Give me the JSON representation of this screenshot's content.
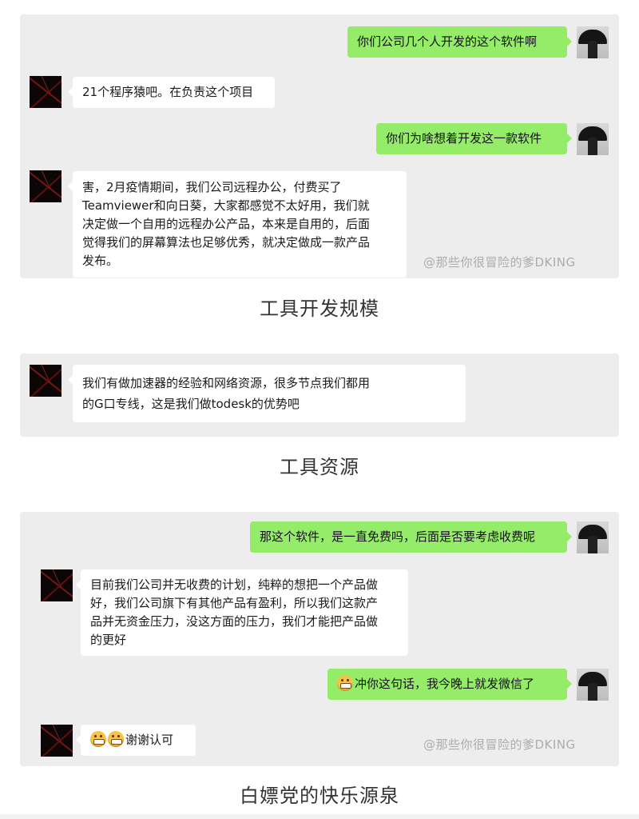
{
  "sections": [
    {
      "caption": "工具开发规模",
      "watermark": "@那些你很冒险的爹DKING",
      "messages": [
        {
          "side": "right",
          "text": "你们公司几个人开发的这个软件啊"
        },
        {
          "side": "left",
          "text": "21个程序猿吧。在负责这个项目"
        },
        {
          "side": "right",
          "text": "你们为啥想着开发这一款软件"
        },
        {
          "side": "left",
          "lines": [
            "害，2月疫情期间，我们公司远程办公，付费买了",
            "Teamviewer和向日葵，大家都感觉不太好用，我们就",
            "决定做一个自用的远程办公产品，本来是自用的，后面",
            "觉得我们的屏幕算法也足够优秀，就决定做成一款产品",
            "发布。"
          ]
        }
      ]
    },
    {
      "caption": "工具资源",
      "messages": [
        {
          "side": "left",
          "lines": [
            "我们有做加速器的经验和网络资源，很多节点我们都用",
            "的G口专线，这是我们做todesk的优势吧"
          ]
        }
      ]
    },
    {
      "caption": "白嫖党的快乐源泉",
      "watermark": "@那些你很冒险的爹DKING",
      "messages": [
        {
          "side": "right",
          "text": "那这个软件，是一直免费吗，后面是否要考虑收费呢"
        },
        {
          "side": "left",
          "lines": [
            "目前我们公司并无收费的计划，纯粹的想把一个产品做",
            "好，我们公司旗下有其他产品有盈利，所以我们这款产",
            "品并无资金压力，没这方面的压力，我们才能把产品做",
            "的更好"
          ]
        },
        {
          "side": "right",
          "text": "冲你这句话，我今晚上就发微信了",
          "emoji": "grin-emoji"
        },
        {
          "side": "left",
          "text": "谢谢认可",
          "emoji": "grin-emoji"
        }
      ]
    }
  ]
}
